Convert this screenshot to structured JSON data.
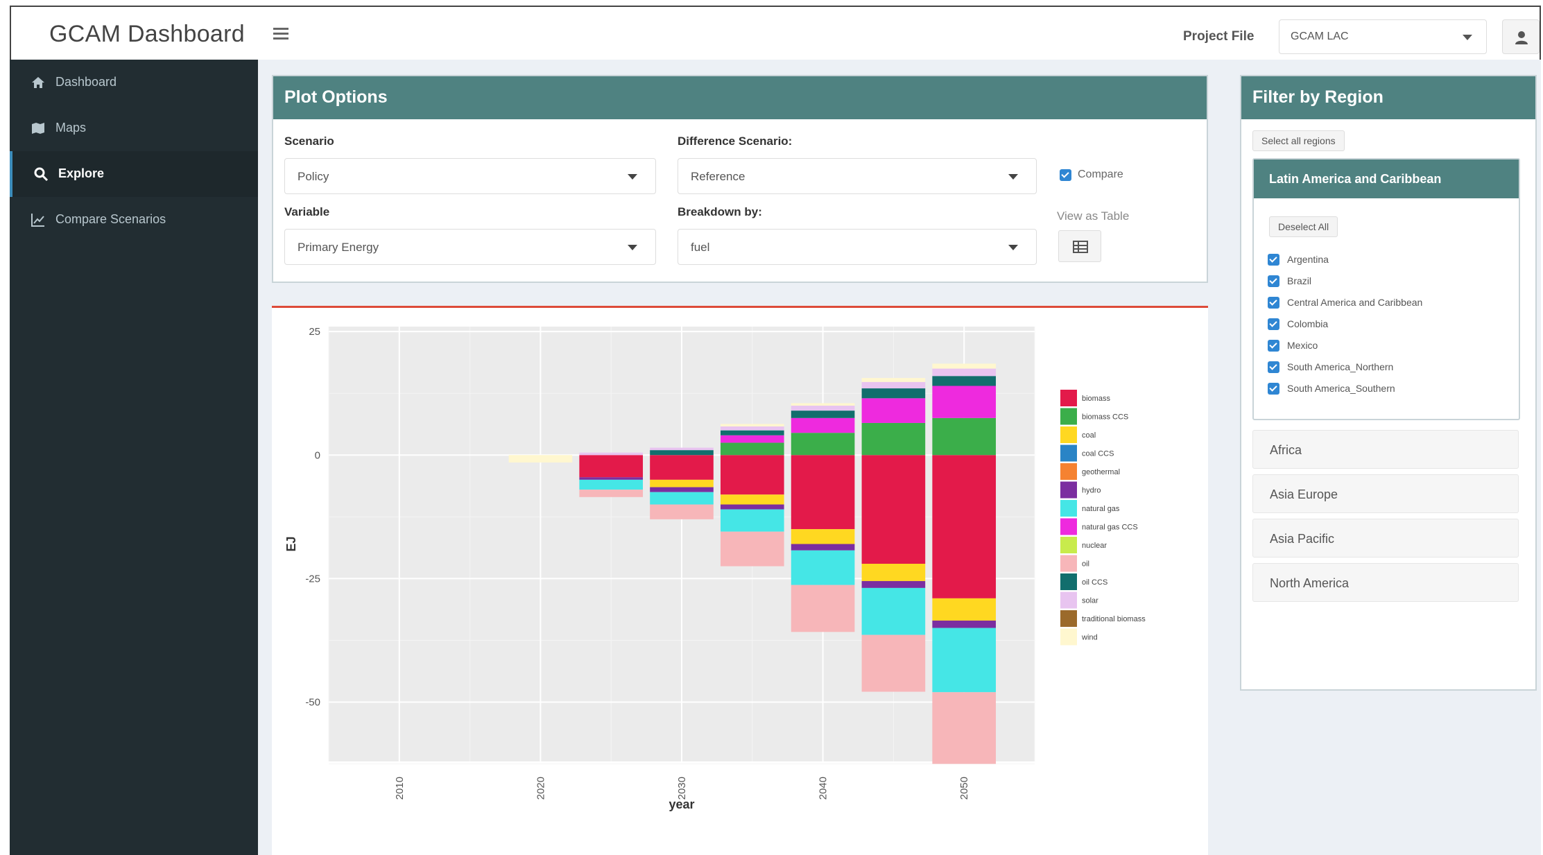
{
  "header": {
    "app_title": "GCAM Dashboard",
    "project_label": "Project File",
    "project_value": "GCAM LAC"
  },
  "sidebar": {
    "items": [
      {
        "label": "Dashboard",
        "icon": "dashboard-icon"
      },
      {
        "label": "Maps",
        "icon": "map-icon"
      },
      {
        "label": "Explore",
        "icon": "search-icon",
        "active": true
      },
      {
        "label": "Compare Scenarios",
        "icon": "line-chart-icon"
      }
    ]
  },
  "plot_options": {
    "title": "Plot Options",
    "scenario_label": "Scenario",
    "scenario_value": "Policy",
    "diff_label": "Difference Scenario:",
    "diff_value": "Reference",
    "compare_label": "Compare",
    "variable_label": "Variable",
    "variable_value": "Primary Energy",
    "breakdown_label": "Breakdown by:",
    "breakdown_value": "fuel",
    "view_table_label": "View as Table"
  },
  "region_filter": {
    "title": "Filter by Region",
    "select_all_label": "Select all regions",
    "group_title": "Latin America and Caribbean",
    "deselect_label": "Deselect All",
    "regions": [
      "Argentina",
      "Brazil",
      "Central America and Caribbean",
      "Colombia",
      "Mexico",
      "South America_Northern",
      "South America_Southern"
    ],
    "collapsed_groups": [
      "Africa",
      "Asia Europe",
      "Asia Pacific",
      "North America"
    ]
  },
  "colors": {
    "box_header": "#4f8281",
    "sidebar": "#222d32",
    "active_accent": "#3c8dbc",
    "chart_top_border": "#dd4b39",
    "checkbox": "#2f86d3"
  },
  "chart_data": {
    "type": "bar",
    "stacked": true,
    "xlabel": "year",
    "ylabel": "EJ",
    "x_ticks": [
      2010,
      2020,
      2030,
      2040,
      2050
    ],
    "y_ticks": [
      25,
      0,
      -25,
      -50
    ],
    "ylim": [
      -62,
      26
    ],
    "xlim": [
      2005,
      2055
    ],
    "grid": true,
    "legend_position": "right",
    "categories": [
      2020,
      2025,
      2030,
      2035,
      2040,
      2045,
      2050
    ],
    "series": [
      {
        "name": "biomass",
        "color": "#e31a4a",
        "values": [
          0,
          -4.5,
          -5,
          -8,
          -15,
          -22,
          -29
        ]
      },
      {
        "name": "biomass CCS",
        "color": "#3bae4a",
        "values": [
          0,
          0,
          0,
          2.5,
          4.5,
          6.5,
          7.5
        ]
      },
      {
        "name": "coal",
        "color": "#ffd821",
        "values": [
          0,
          0,
          -1.5,
          -2,
          -3,
          -3.5,
          -4.5
        ]
      },
      {
        "name": "coal CCS",
        "color": "#2a84c6",
        "values": [
          0,
          0,
          0,
          0,
          0,
          0,
          0
        ]
      },
      {
        "name": "geothermal",
        "color": "#f58231",
        "values": [
          0,
          0,
          0,
          0,
          0,
          0,
          0
        ]
      },
      {
        "name": "hydro",
        "color": "#7b2ea0",
        "values": [
          0,
          -0.5,
          -1,
          -1,
          -1.3,
          -1.4,
          -1.5
        ]
      },
      {
        "name": "natural gas",
        "color": "#45e6e6",
        "values": [
          0,
          -2,
          -2.5,
          -4.5,
          -7,
          -9.5,
          -13
        ]
      },
      {
        "name": "natural gas CCS",
        "color": "#ee2ade",
        "values": [
          0,
          0,
          0,
          1.5,
          3,
          5,
          6.5
        ]
      },
      {
        "name": "nuclear",
        "color": "#c8eb4c",
        "values": [
          0,
          0,
          0,
          0,
          0,
          0,
          0
        ]
      },
      {
        "name": "oil",
        "color": "#f7b6b9",
        "values": [
          0,
          -1.5,
          -3,
          -7,
          -9.5,
          -11.5,
          -14.5
        ]
      },
      {
        "name": "oil CCS",
        "color": "#126e6d",
        "values": [
          0,
          0,
          1,
          1,
          1.5,
          2,
          2
        ]
      },
      {
        "name": "solar",
        "color": "#e8c4f0",
        "values": [
          0,
          0.5,
          0.5,
          0.8,
          1,
          1.3,
          1.5
        ]
      },
      {
        "name": "traditional biomass",
        "color": "#9b6a2b",
        "values": [
          0,
          0,
          0,
          0,
          0,
          0,
          0
        ]
      },
      {
        "name": "wind",
        "color": "#fff7cf",
        "values": [
          -1.5,
          0,
          0,
          0.5,
          0.5,
          0.8,
          1
        ]
      }
    ]
  }
}
